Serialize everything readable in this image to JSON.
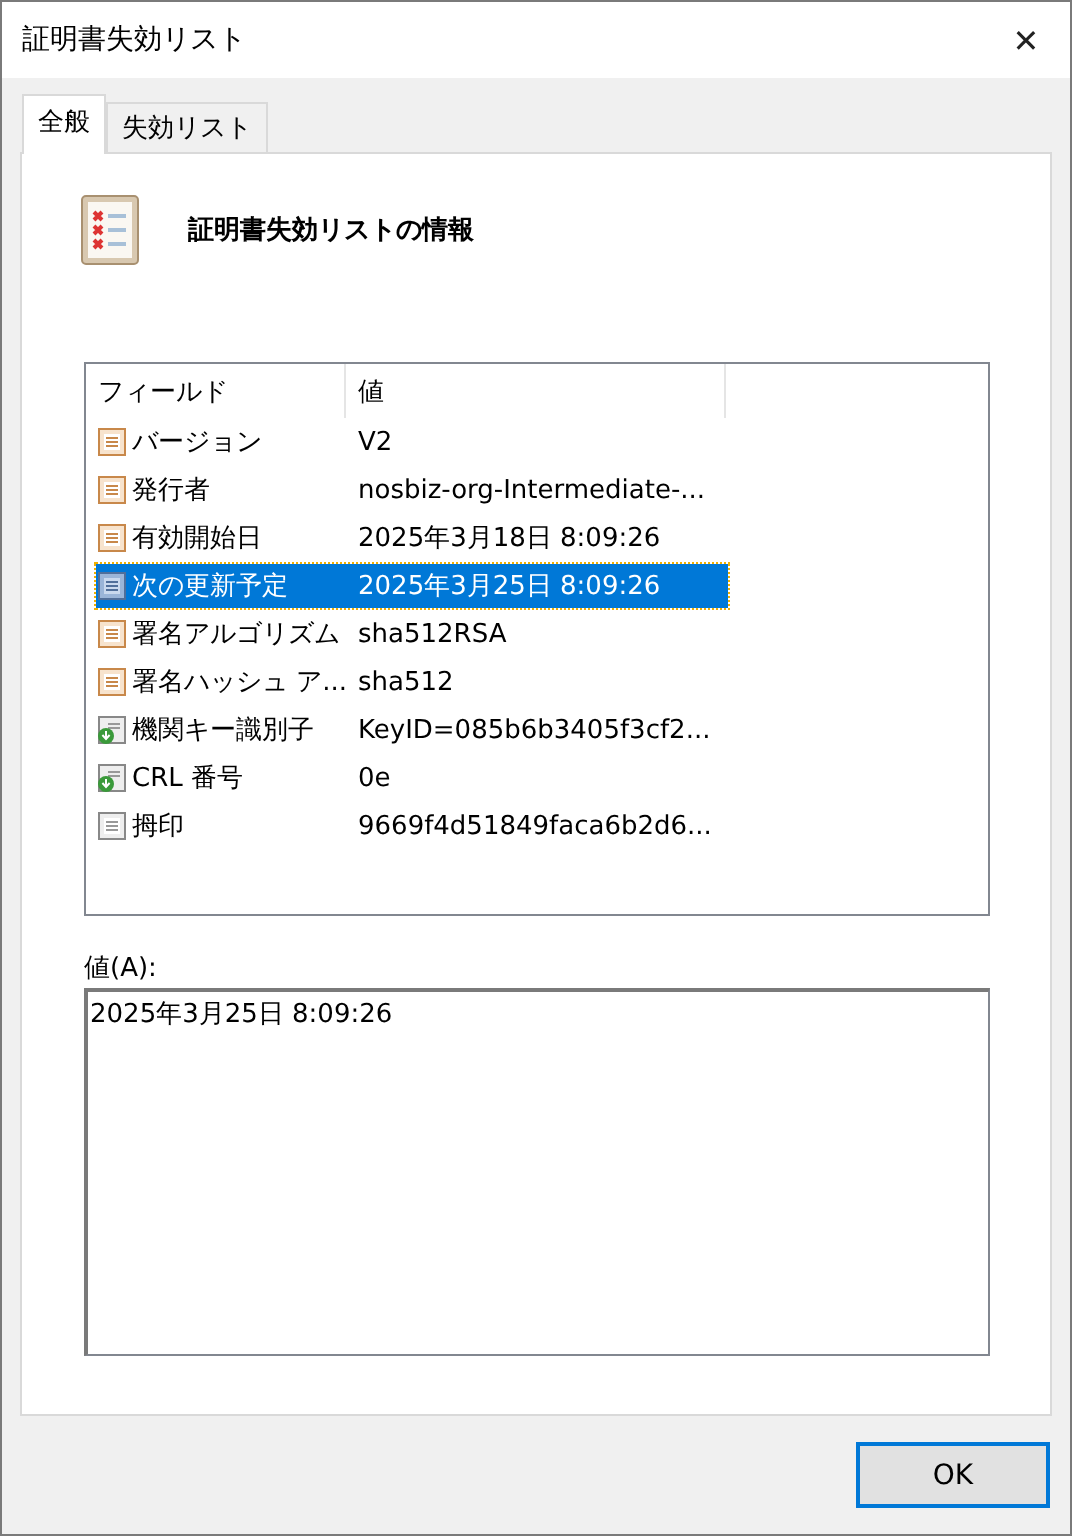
{
  "window": {
    "title": "証明書失効リスト",
    "close": "✕"
  },
  "tabs": [
    {
      "label": "全般",
      "selected": true
    },
    {
      "label": "失効リスト",
      "selected": false
    }
  ],
  "heading": "証明書失効リストの情報",
  "list": {
    "columns": [
      "フィールド",
      "値"
    ],
    "rows": [
      {
        "kind": "field",
        "field": "バージョン",
        "value": "V2",
        "selected": false
      },
      {
        "kind": "field",
        "field": "発行者",
        "value": "nosbiz-org-Intermediate-...",
        "selected": false
      },
      {
        "kind": "field",
        "field": "有効開始日",
        "value": "2025年3月18日 8:09:26",
        "selected": false
      },
      {
        "kind": "field",
        "field": "次の更新予定",
        "value": "2025年3月25日 8:09:26",
        "selected": true
      },
      {
        "kind": "field",
        "field": "署名アルゴリズム",
        "value": "sha512RSA",
        "selected": false
      },
      {
        "kind": "field",
        "field": "署名ハッシュ ア...",
        "value": "sha512",
        "selected": false
      },
      {
        "kind": "extension",
        "field": "機関キー識別子",
        "value": "KeyID=085b6b3405f3cf2...",
        "selected": false
      },
      {
        "kind": "extension",
        "field": "CRL 番号",
        "value": "0e",
        "selected": false
      },
      {
        "kind": "property",
        "field": "拇印",
        "value": "9669f4d51849faca6b2d6...",
        "selected": false
      }
    ]
  },
  "value_label": "値(A):",
  "value_text": "2025年3月25日 8:09:26",
  "buttons": [
    "OK"
  ]
}
